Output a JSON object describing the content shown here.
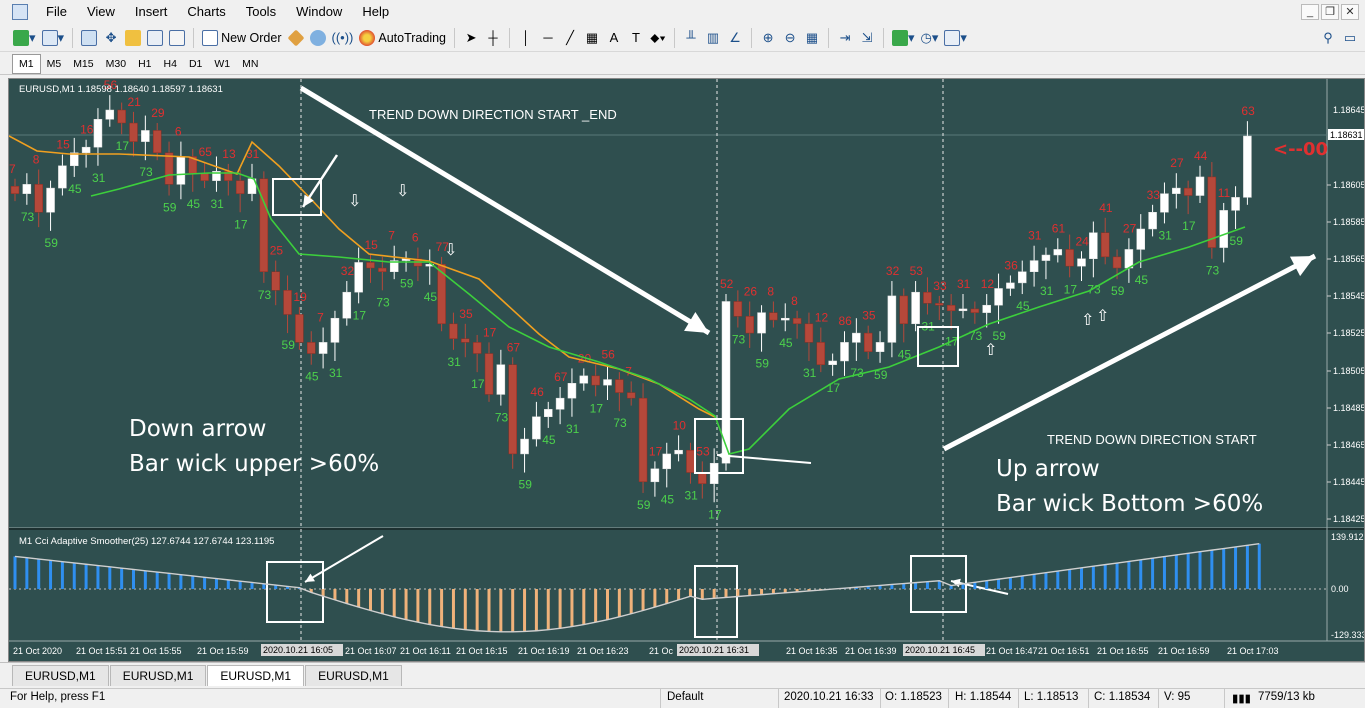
{
  "menu": [
    "File",
    "View",
    "Insert",
    "Charts",
    "Tools",
    "Window",
    "Help"
  ],
  "toolbar": {
    "new_order": "New Order",
    "autotrading": "AutoTrading"
  },
  "timeframes": [
    "M1",
    "M5",
    "M15",
    "M30",
    "H1",
    "H4",
    "D1",
    "W1",
    "MN"
  ],
  "active_timeframe": "M1",
  "chart": {
    "header": "EURUSD,M1  1.18598 1.18640 1.18597 1.18631",
    "current_price": "1.18631",
    "price_ticks": [
      "1.18645",
      "1.18605",
      "1.18585",
      "1.18565",
      "1.18545",
      "1.18525",
      "1.18505",
      "1.18485",
      "1.18465",
      "1.18445",
      "1.18425"
    ],
    "indicator_header": "M1 Cci Adaptive Smoother(25) 127.6744 127.6744 123.1195",
    "indicator_ticks": [
      "139.9121",
      "0.00",
      "-129.333"
    ],
    "time_labels": [
      "21 Oct 2020",
      "21 Oct 15:51",
      "21 Oct 15:55",
      "21 Oct 15:59",
      "21 Oct 16:07",
      "21 Oct 16:11",
      "21 Oct 16:15",
      "21 Oct 16:19",
      "21 Oct 16:23",
      "21 Oc",
      "31",
      "21 Oct 16:35",
      "21 Oct 16:39",
      "21 Oct 16:47",
      "21 Oct 16:51",
      "21 Oct 16:55",
      "21 Oct 16:59",
      "21 Oct 17:03"
    ],
    "crosshair_times": [
      "2020.10.21 16:05",
      "2020.10.21 16:31",
      "2020.10.21 16:45"
    ],
    "annotations": {
      "trend_top": "TREND DOWN DIRECTION START _END",
      "trend_right": "TREND DOWN DIRECTION START",
      "down_title": "Down arrow",
      "down_desc": "Bar wick upper >60%",
      "up_title": "Up arrow",
      "up_desc": "Bar wick Bottom >60%",
      "right_marker": "<--00"
    },
    "colors": {
      "background": "#2f4f4f",
      "bull": "#ffffff",
      "bear": "#b5483a",
      "ma_orange": "#f0a020",
      "ma_green": "#3ccf3c",
      "cci_pos": "#2f8ff0",
      "cci_neg": "#f0b27a",
      "label_red": "#e03030",
      "label_green": "#4cd14c"
    }
  },
  "tabs": [
    "EURUSD,M1",
    "EURUSD,M1",
    "EURUSD,M1",
    "EURUSD,M1"
  ],
  "active_tab": 2,
  "status": {
    "help": "For Help, press F1",
    "profile": "Default",
    "datetime": "2020.10.21 16:33",
    "open": "O: 1.18523",
    "high": "H: 1.18544",
    "low": "L: 1.18513",
    "close": "C: 1.18534",
    "volume": "V: 95",
    "traffic": "7759/13 kb"
  }
}
